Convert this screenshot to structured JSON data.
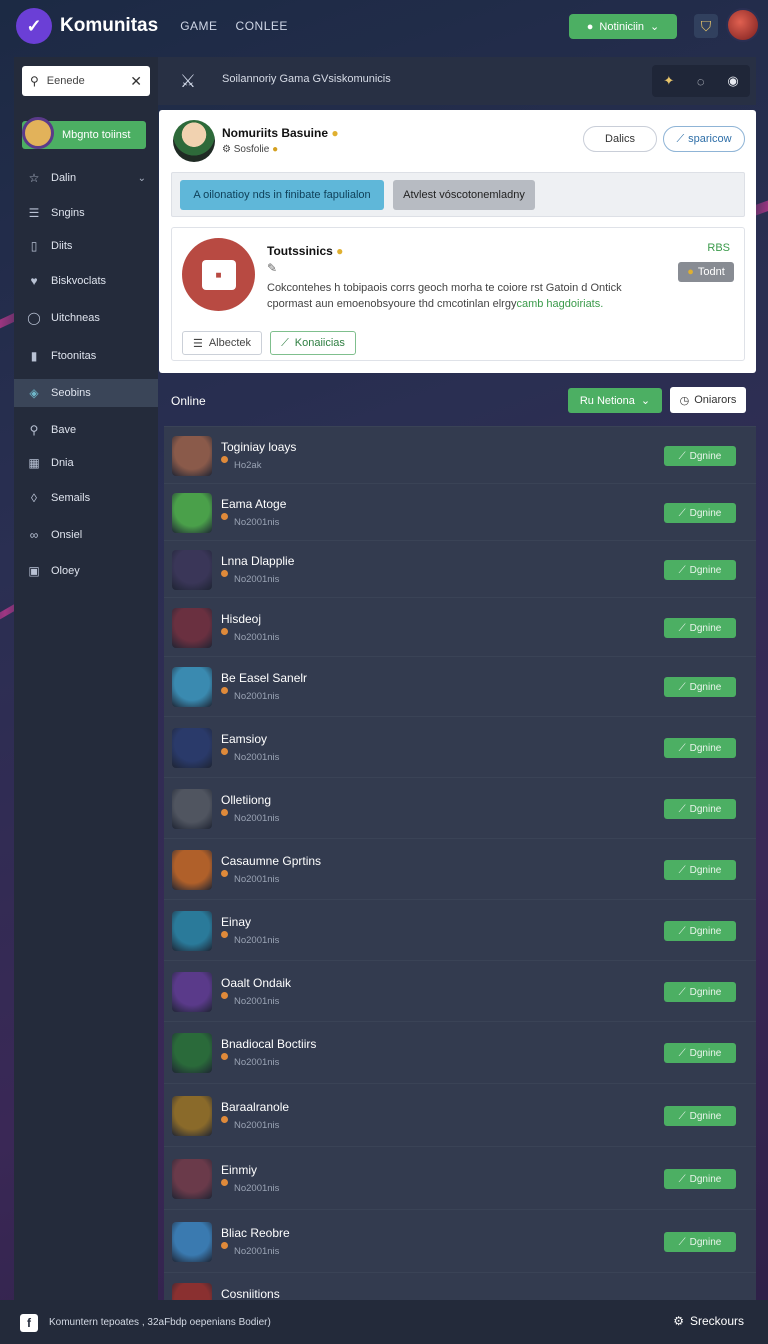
{
  "topbar": {
    "brand": "Komunitas",
    "nav": [
      "GAME",
      "CONLEE"
    ],
    "notif_label": "Notiniciin",
    "icons": {
      "logo": "chat-bubble-icon",
      "notif": "bell-icon",
      "shield": "shield-icon",
      "avatar": "user-avatar"
    }
  },
  "sidebar": {
    "search_label": "Eenede",
    "profile_label": "Mbgnto toiinst",
    "items": [
      {
        "label": "Dalin",
        "icon": "star-icon"
      },
      {
        "label": "Sngins",
        "icon": "list-icon"
      },
      {
        "label": "Diits",
        "icon": "document-icon"
      },
      {
        "label": "Biskvoclats",
        "icon": "heart-icon"
      },
      {
        "label": "Uitchneas",
        "icon": "user-icon"
      },
      {
        "label": "Ftoonitas",
        "icon": "bookmark-icon"
      },
      {
        "label": "Seobins",
        "icon": "game-icon"
      },
      {
        "label": "Bave",
        "icon": "search-icon"
      },
      {
        "label": "Dnia",
        "icon": "grid-icon"
      },
      {
        "label": "Semails",
        "icon": "location-icon"
      },
      {
        "label": "Onsiel",
        "icon": "link-icon"
      },
      {
        "label": "Oloey",
        "icon": "calendar-icon"
      }
    ]
  },
  "strip": {
    "text": "Soilannoriy Gama GVsiskomunicis"
  },
  "profile": {
    "title": "Nomuriits Basuine",
    "subtitle": "Sosfolie",
    "btn_dalics": "Dalics",
    "btn_sparicow": "sparicow",
    "tag_blue": "A oilonatioy nds in finibate fapulialon",
    "tag_gray": "Atvlest vóscotonemladny"
  },
  "card": {
    "title": "Toutssinics",
    "label": "RBS",
    "badge": "Todnt",
    "desc_main": "Cokcontehes h tobipaois corrs geoch morha te coiore rst Gatoin d Ontick cpormast aun emoenobsyoure thd cmcotinlan elrgy",
    "desc_highlight": "camb hagdoiriats.",
    "btn1": "Albectek",
    "btn2": "Konaiicias"
  },
  "online": {
    "title": "Online",
    "btn_green": "Ru Netiona",
    "btn_white": "Oniarors"
  },
  "rows": [
    {
      "name": "Toginiay loays",
      "meta": "Ho2ak",
      "btn": "Dgnine",
      "color": "#8a5a4a"
    },
    {
      "name": "Eama  Atoge",
      "meta": "No2001nis",
      "btn": "Dgnine",
      "color": "#4aa04a"
    },
    {
      "name": "Lnna  Dlapplie",
      "meta": "No2001nis",
      "btn": "Dgnine",
      "color": "#3a3658"
    },
    {
      "name": "Hisdeoj",
      "meta": "No2001nis",
      "btn": "Dgnine",
      "color": "#6a3040"
    },
    {
      "name": "Be Easel Sanelr",
      "meta": "No2001nis",
      "btn": "Dgnine",
      "color": "#3a8ab0"
    },
    {
      "name": "Eamsioy",
      "meta": "No2001nis",
      "btn": "Dgnine",
      "color": "#2a3a6a"
    },
    {
      "name": "Olletiiong",
      "meta": "No2001nis",
      "btn": "Dgnine",
      "color": "#505560"
    },
    {
      "name": "Casaumne Gprtins",
      "meta": "No2001nis",
      "btn": "Dgnine",
      "color": "#b0602a"
    },
    {
      "name": "Einay",
      "meta": "No2001nis",
      "btn": "Dgnine",
      "color": "#2a7a9a"
    },
    {
      "name": "Oaalt  Ondaik",
      "meta": "No2001nis",
      "btn": "Dgnine",
      "color": "#5a3a8a"
    },
    {
      "name": "Bnadiocal Boctiirs",
      "meta": "No2001nis",
      "btn": "Dgnine",
      "color": "#2a6a3a"
    },
    {
      "name": "Baraalranole",
      "meta": "No2001nis",
      "btn": "Dgnine",
      "color": "#8a6a2a"
    },
    {
      "name": "Einmiy",
      "meta": "No2001nis",
      "btn": "Dgnine",
      "color": "#6a3a4a"
    },
    {
      "name": "Bliac Reobre",
      "meta": "No2001nis",
      "btn": "Dgnine",
      "color": "#3a7ab0"
    },
    {
      "name": "Cosniitions",
      "meta": "",
      "btn": "",
      "color": "#8a3030"
    }
  ],
  "footer": {
    "text": "Komuntern tepoates , 32aFbdp oepenians Bodier)",
    "right_label": "Sreckours"
  }
}
